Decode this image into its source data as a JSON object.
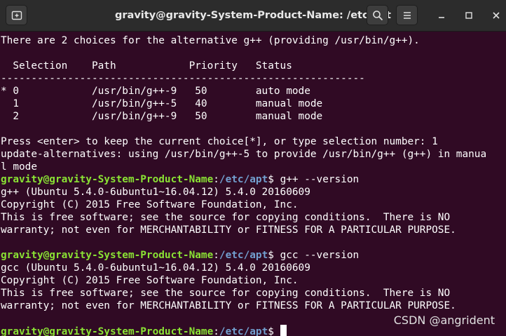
{
  "window": {
    "title": "gravity@gravity-System-Product-Name: /etc/apt",
    "icons": [
      "new-tab-icon",
      "search-icon",
      "hamburger-menu-icon",
      "minimize-icon",
      "maximize-icon",
      "close-icon"
    ]
  },
  "terminal": {
    "colors": {
      "background": "#300a24",
      "text": "#ffffff",
      "user": "#8ae234",
      "path": "#729fcf"
    },
    "lines": [
      "There are 2 choices for the alternative g++ (providing /usr/bin/g++).",
      "",
      "  Selection    Path            Priority   Status",
      "------------------------------------------------------------",
      "* 0            /usr/bin/g++-9   50        auto mode",
      "  1            /usr/bin/g++-5   40        manual mode",
      "  2            /usr/bin/g++-9   50        manual mode",
      "",
      "Press <enter> to keep the current choice[*], or type selection number: 1",
      "update-alternatives: using /usr/bin/g++-5 to provide /usr/bin/g++ (g++) in manua",
      "l mode"
    ],
    "prompt1": {
      "user": "gravity@gravity-System-Product-Name",
      "sep": ":",
      "path": "/etc/apt",
      "symbol": "$",
      "command": " g++ --version"
    },
    "output1": [
      "g++ (Ubuntu 5.4.0-6ubuntu1~16.04.12) 5.4.0 20160609",
      "Copyright (C) 2015 Free Software Foundation, Inc.",
      "This is free software; see the source for copying conditions.  There is NO",
      "warranty; not even for MERCHANTABILITY or FITNESS FOR A PARTICULAR PURPOSE.",
      ""
    ],
    "prompt2": {
      "user": "gravity@gravity-System-Product-Name",
      "sep": ":",
      "path": "/etc/apt",
      "symbol": "$",
      "command": " gcc --version"
    },
    "output2": [
      "gcc (Ubuntu 5.4.0-6ubuntu1~16.04.12) 5.4.0 20160609",
      "Copyright (C) 2015 Free Software Foundation, Inc.",
      "This is free software; see the source for copying conditions.  There is NO",
      "warranty; not even for MERCHANTABILITY or FITNESS FOR A PARTICULAR PURPOSE.",
      ""
    ],
    "prompt3": {
      "user": "gravity@gravity-System-Product-Name",
      "sep": ":",
      "path": "/etc/apt",
      "symbol": "$",
      "command": " "
    }
  },
  "watermark": "CSDN @angrident"
}
